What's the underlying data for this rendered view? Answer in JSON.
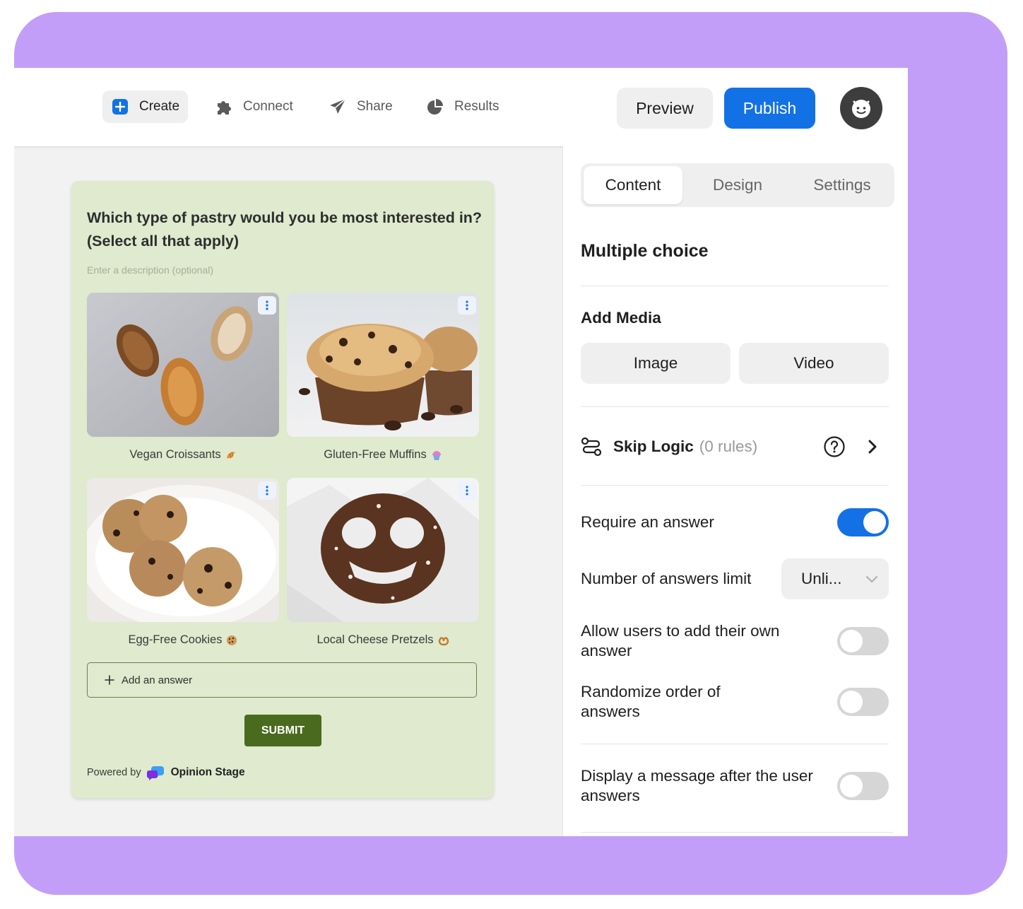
{
  "nav": {
    "items": [
      {
        "label": "Create",
        "icon": "plus-square-icon",
        "active": true
      },
      {
        "label": "Connect",
        "icon": "puzzle-icon"
      },
      {
        "label": "Share",
        "icon": "paper-plane-icon"
      },
      {
        "label": "Results",
        "icon": "pie-chart-icon"
      }
    ],
    "preview_label": "Preview",
    "publish_label": "Publish",
    "accent": "#1371e6"
  },
  "question": {
    "title": "Which type of pastry would you be most interested in? (Select all that apply)",
    "description_placeholder": "Enter a description (optional)",
    "answers": [
      {
        "label": "Vegan Croissants",
        "emoji_icon": "croissant-emoji-icon"
      },
      {
        "label": "Gluten-Free Muffins",
        "emoji_icon": "cupcake-emoji-icon"
      },
      {
        "label": "Egg-Free Cookies",
        "emoji_icon": "cookie-emoji-icon"
      },
      {
        "label": "Local Cheese Pretzels",
        "emoji_icon": "pretzel-emoji-icon"
      }
    ],
    "add_answer_label": "Add an answer",
    "submit_label": "SUBMIT",
    "powered_by": "Powered by",
    "brand": "Opinion Stage",
    "card_color": "#dfeace",
    "submit_color": "#4a6b1e"
  },
  "panel": {
    "tabs": [
      "Content",
      "Design",
      "Settings"
    ],
    "active_tab": "Content",
    "section_title": "Multiple choice",
    "add_media": {
      "title": "Add Media",
      "image_label": "Image",
      "video_label": "Video"
    },
    "skip_logic": {
      "label": "Skip Logic",
      "rules": "(0 rules)"
    },
    "require_answer": {
      "label": "Require an answer",
      "enabled": true
    },
    "answers_limit": {
      "label": "Number of answers limit",
      "value": "Unli..."
    },
    "allow_own_answer": {
      "label": "Allow users to add their own answer",
      "enabled": false
    },
    "randomize": {
      "label": "Randomize order of answers",
      "enabled": false
    },
    "display_message": {
      "label": "Display a message after the user answers",
      "enabled": false
    }
  }
}
